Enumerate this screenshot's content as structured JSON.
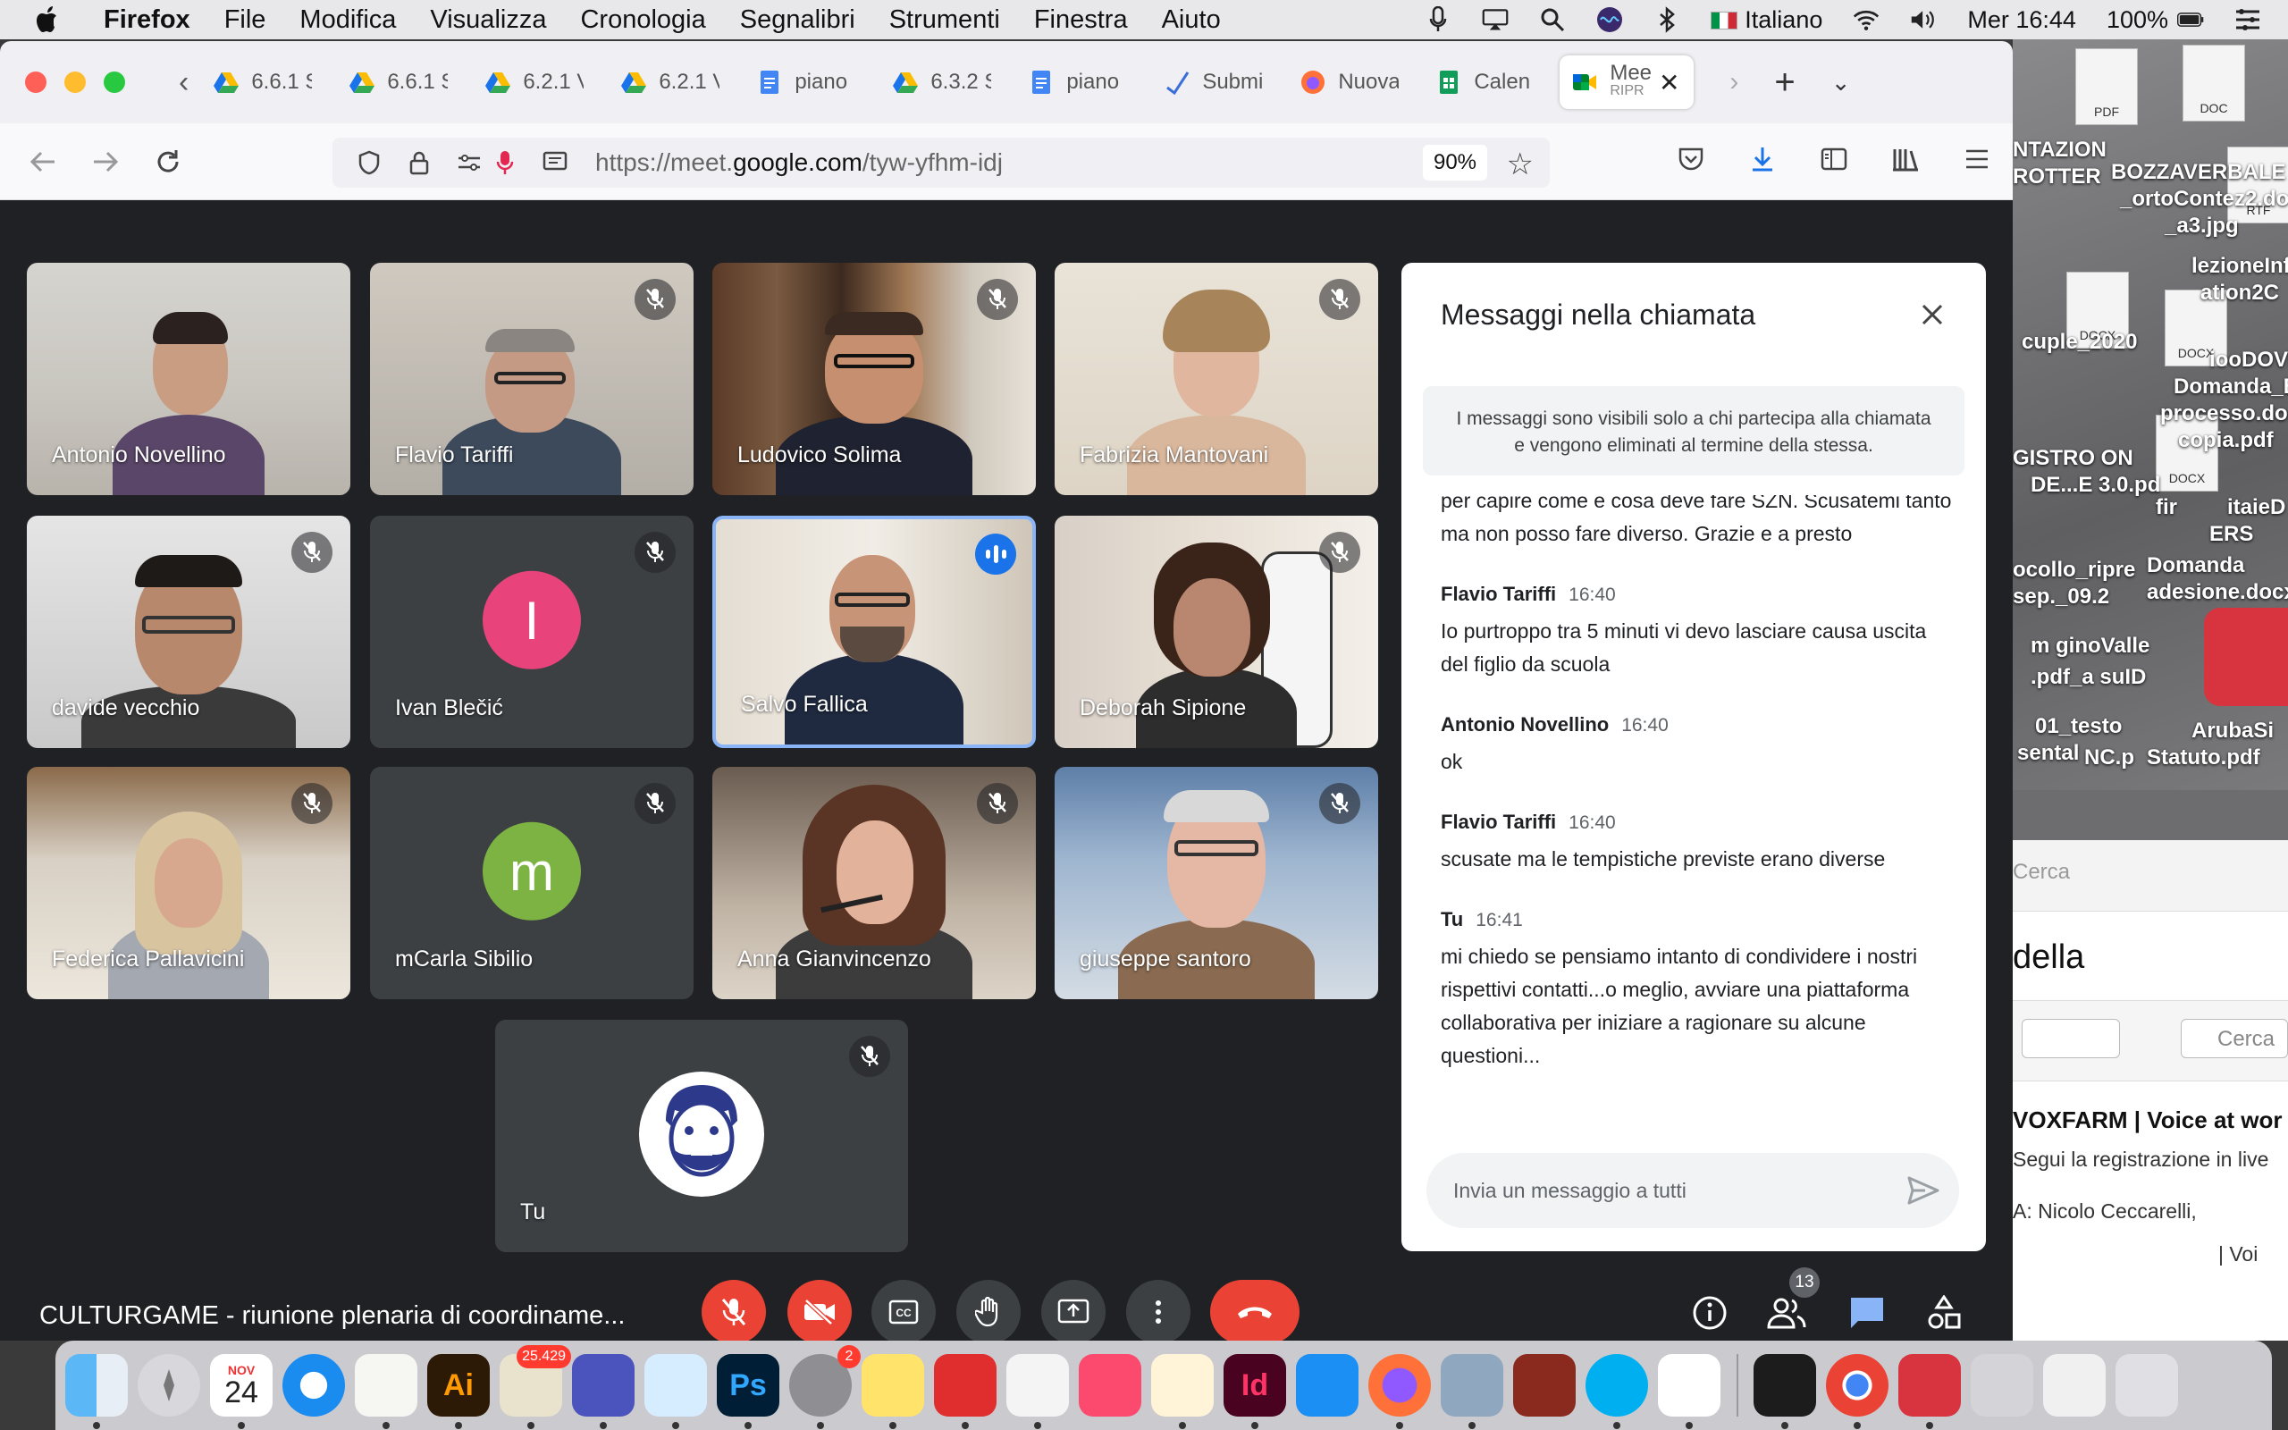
{
  "menubar": {
    "app_name": "Firefox",
    "menus": [
      "File",
      "Modifica",
      "Visualizza",
      "Cronologia",
      "Segnalibri",
      "Strumenti",
      "Finestra",
      "Aiuto"
    ],
    "input_language": "Italiano",
    "clock": "Mer 16:44",
    "battery": "100%"
  },
  "browser": {
    "tabs": [
      {
        "title": "6.6.1 S",
        "icon": "google-drive-icon"
      },
      {
        "title": "6.6.1 S",
        "icon": "google-drive-icon"
      },
      {
        "title": "6.2.1 V",
        "icon": "google-drive-icon"
      },
      {
        "title": "6.2.1 V",
        "icon": "google-drive-icon"
      },
      {
        "title": "piano",
        "icon": "google-docs-icon"
      },
      {
        "title": "6.3.2 S",
        "icon": "google-drive-icon"
      },
      {
        "title": "piano",
        "icon": "google-docs-icon"
      },
      {
        "title": "Submi",
        "icon": "submit-icon"
      },
      {
        "title": "Nuova",
        "icon": "firefox-icon"
      },
      {
        "title": "Calen",
        "icon": "google-sheets-icon"
      },
      {
        "title": "Mee",
        "subtitle": "RIPR",
        "icon": "google-meet-icon",
        "active": true
      }
    ],
    "url_prefix": "https://meet.",
    "url_domain": "google.com",
    "url_path": "/tyw-yfhm-idj",
    "zoom": "90%"
  },
  "meet": {
    "participants": [
      {
        "name": "Antonio Novellino",
        "muted": false
      },
      {
        "name": "Flavio Tariffi",
        "muted": true
      },
      {
        "name": "Ludovico Solima",
        "muted": true
      },
      {
        "name": "Fabrizia Mantovani",
        "muted": true
      },
      {
        "name": "davide vecchio",
        "muted": true
      },
      {
        "name": "Ivan Blečić",
        "muted": true,
        "initial": "I",
        "avatar_color": "#e8437b"
      },
      {
        "name": "Salvo Fallica",
        "muted": false,
        "speaking": true
      },
      {
        "name": "Deborah Sipione",
        "muted": true
      },
      {
        "name": "Federica Pallavicini",
        "muted": true
      },
      {
        "name": "mCarla Sibilio",
        "muted": true,
        "initial": "m",
        "avatar_color": "#7cb342"
      },
      {
        "name": "Anna Gianvincenzo",
        "muted": true
      },
      {
        "name": "giuseppe santoro",
        "muted": true
      },
      {
        "name": "Tu",
        "muted": true
      }
    ],
    "chat": {
      "title": "Messaggi nella chiamata",
      "notice": "I messaggi sono visibili solo a chi partecipa alla chiamata e vengono eliminati al termine della stessa.",
      "partial_message": "per capire come e cosa deve fare SZN. Scusatemi tanto ma non posso fare diverso. Grazie e a presto",
      "messages": [
        {
          "sender": "Flavio Tariffi",
          "time": "16:40",
          "text": "Io purtroppo tra 5 minuti vi devo lasciare causa uscita del figlio da scuola"
        },
        {
          "sender": "Antonio Novellino",
          "time": "16:40",
          "text": "ok"
        },
        {
          "sender": "Flavio Tariffi",
          "time": "16:40",
          "text": "scusate ma le tempistiche previste erano diverse"
        },
        {
          "sender": "Tu",
          "time": "16:41",
          "text": "mi chiedo se pensiamo intanto di condividere i nostri rispettivi contatti...o meglio, avviare una piattaforma collaborativa per iniziare a ragionare su alcune questioni..."
        }
      ],
      "input_placeholder": "Invia un messaggio a tutti"
    },
    "meeting_title": "CULTURGAME - riunione plenaria di coordiname...",
    "participant_count": "13",
    "colors": {
      "accent": "#1a73e8",
      "danger": "#ea4335",
      "speaking_border": "#8ab4f8"
    }
  },
  "desktop": {
    "labels": [
      "NTAZION",
      "ROTTER",
      "BOZZAVERBALE",
      "_ortoContez2.do",
      "_a3.jpg",
      "lezioneInfo",
      "ation2C",
      "cuple_2020",
      "iooDOVE",
      "Domanda_Bee",
      "processo.docx",
      "copia.pdf",
      "GISTRO ON",
      "DE...E 3.0.pd",
      "fir",
      "itaieD",
      "ERS",
      "ocollo_ripre",
      "Domanda",
      "sep._09.2",
      "adesione.docx",
      "m ginoValle",
      ".pdf_a suID",
      "01_testo",
      "ArubaSi",
      "sental",
      "NC.p",
      "Statuto.pdf"
    ],
    "doc_badges": [
      "PDF",
      "DOC",
      "RTF",
      "DOCX",
      "DOCX",
      "DOCX"
    ],
    "bg_window": {
      "search_placeholder": "Cerca",
      "heading": "della",
      "feed_title": "VOXFARM | Voice at wor",
      "feed_line": "Segui la registrazione in live",
      "feed_line2": "A:  Nicolo Ceccarelli,",
      "feed_extra": "| Voi"
    }
  },
  "dock": {
    "calendar_month": "NOV",
    "calendar_day": "24",
    "mail_badge": "25.429",
    "settings_badge": "2"
  }
}
